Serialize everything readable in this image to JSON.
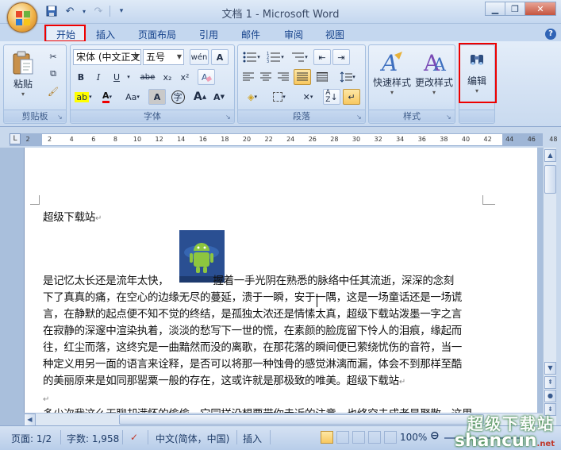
{
  "window": {
    "title": "文档 1 - Microsoft Word"
  },
  "tabs": [
    "开始",
    "插入",
    "页面布局",
    "引用",
    "邮件",
    "审阅",
    "视图"
  ],
  "clipboard": {
    "paste_label": "粘贴",
    "group_label": "剪贴板"
  },
  "font": {
    "name_value": "宋体 (中文正文",
    "size_value": "五号",
    "group_label": "字体",
    "buttons": [
      "B",
      "I",
      "U",
      "abe",
      "x₂",
      "x²",
      "Aa",
      "A",
      "字",
      "A",
      "A"
    ]
  },
  "paragraph": {
    "group_label": "段落"
  },
  "styles": {
    "quick_label": "快速样式",
    "change_label": "更改样式",
    "group_label": "样式"
  },
  "editing": {
    "label": "编辑"
  },
  "ruler": {
    "ticks": [
      "2",
      "2",
      "4",
      "6",
      "8",
      "10",
      "12",
      "14",
      "16",
      "18",
      "20",
      "22",
      "24",
      "26",
      "28",
      "30",
      "32",
      "34",
      "36",
      "38",
      "40",
      "42",
      "44",
      "46",
      "48"
    ]
  },
  "document": {
    "heading": "超级下载站",
    "para_before_image": "是记忆太长还是流年太快，",
    "para_after_image": "握着一手光阴在熟悉的脉络中任其流逝，深深的念刻",
    "lines": [
      "下了真真的痛，在空心的边缘无尽的蔓延，溃于一瞬，安于一隅，这是一场童话还是一场谎",
      "言，在静默的起点便不知不觉的终结，是孤独太浓还是情愫太真，超级下载站泼墨一字之言",
      "在寂静的深邃中渲染执着，淡淡的愁写下一世的慌，在素颜的脸庞留下怜人的泪痕，缘起而",
      "往，红尘而落，这终究是一曲黯然而没的离歌，在那花落的瞬间便已萦绕忧伤的音符，当一",
      "种定义用另一面的语言来诠释，是否可以将那一种蚀骨的感觉淋漓而漏，体会不到那样至酷",
      "的美丽原来是如同那罂粟一般的存在，这或许就是那极致的唯美。超级下载站"
    ],
    "partial_line": "多少次我这么无聊却满怀的偷偷，它同样没想要带你走近的注意，也终究未成者是聚散，这里"
  },
  "status": {
    "page": "页面: 1/2",
    "words": "字数: 1,958",
    "language": "中文(简体，中国)",
    "mode": "插入",
    "zoom": "100%"
  },
  "watermark": {
    "top": "超级下载站",
    "bottom": "shancun",
    "suffix": ".net"
  }
}
